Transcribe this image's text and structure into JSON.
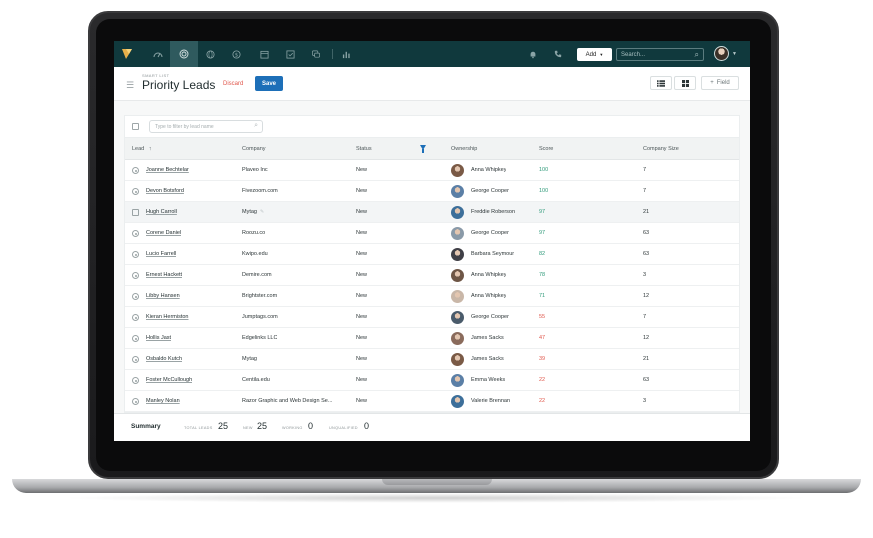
{
  "topbar": {
    "nav_icons": [
      "logo-icon",
      "gauge-icon",
      "target-icon",
      "globe-icon",
      "dollar-icon",
      "calendar-icon",
      "check-icon",
      "chat-icon",
      "chart-icon"
    ],
    "add_label": "Add",
    "search_placeholder": "Search..."
  },
  "header": {
    "smart_list_label": "SMART LIST",
    "title": "Priority Leads",
    "discard_label": "Discard",
    "save_label": "Save",
    "field_label": "Field"
  },
  "filter": {
    "placeholder": "Type to filter by lead name"
  },
  "table": {
    "columns": {
      "lead": "Lead",
      "company": "Company",
      "status": "Status",
      "ownership": "Ownership",
      "score": "Score",
      "company_size": "Company Size"
    },
    "rows": [
      {
        "lead": "Joanne Bechtelar",
        "company": "Plaveo Inc",
        "status": "New",
        "owner": "Anna Whipkey",
        "score": "100",
        "size": "7"
      },
      {
        "lead": "Devon Botsford",
        "company": "Fivezoom.com",
        "status": "New",
        "owner": "George Cooper",
        "score": "100",
        "size": "7"
      },
      {
        "lead": "Hugh Carroll",
        "company": "Mytag",
        "status": "New",
        "owner": "Freddie Roberson",
        "score": "97",
        "size": "21"
      },
      {
        "lead": "Corene Daniel",
        "company": "Roozu.co",
        "status": "New",
        "owner": "George Cooper",
        "score": "97",
        "size": "63"
      },
      {
        "lead": "Lucio Farrell",
        "company": "Kwipo.edu",
        "status": "New",
        "owner": "Barbara Seymour",
        "score": "82",
        "size": "63"
      },
      {
        "lead": "Ernest Hackett",
        "company": "Demire.com",
        "status": "New",
        "owner": "Anna Whipkey",
        "score": "78",
        "size": "3"
      },
      {
        "lead": "Libby Hansen",
        "company": "Brightster.com",
        "status": "New",
        "owner": "Anna Whipkey",
        "score": "71",
        "size": "12"
      },
      {
        "lead": "Kieran Hermiston",
        "company": "Jumptags.com",
        "status": "New",
        "owner": "George Cooper",
        "score": "55",
        "size": "7"
      },
      {
        "lead": "Hollis Jast",
        "company": "Edgelinks LLC",
        "status": "New",
        "owner": "James Sacks",
        "score": "47",
        "size": "12"
      },
      {
        "lead": "Osbaldo Kutch",
        "company": "Mytag",
        "status": "New",
        "owner": "James Sacks",
        "score": "39",
        "size": "21"
      },
      {
        "lead": "Foster McCullough",
        "company": "Centila.edu",
        "status": "New",
        "owner": "Emma Weeks",
        "score": "22",
        "size": "63"
      },
      {
        "lead": "Manley Nolan",
        "company": "Razor Graphic and Web Design Se...",
        "status": "New",
        "owner": "Valerie Brennan",
        "score": "22",
        "size": "3"
      }
    ]
  },
  "summary": {
    "title": "Summary",
    "total_label": "TOTAL LEADS",
    "total_value": "25",
    "new_label": "NEW",
    "new_value": "25",
    "working_label": "WORKING",
    "working_value": "0",
    "unqualified_label": "UNQUALIFIED",
    "unqualified_value": "0"
  },
  "colors": {
    "topbar_bg": "#10393d",
    "primary_blue": "#1d6fb8",
    "discard_red": "#e0574c",
    "score_high": "#2f9a7a",
    "score_low": "#e0574c"
  }
}
